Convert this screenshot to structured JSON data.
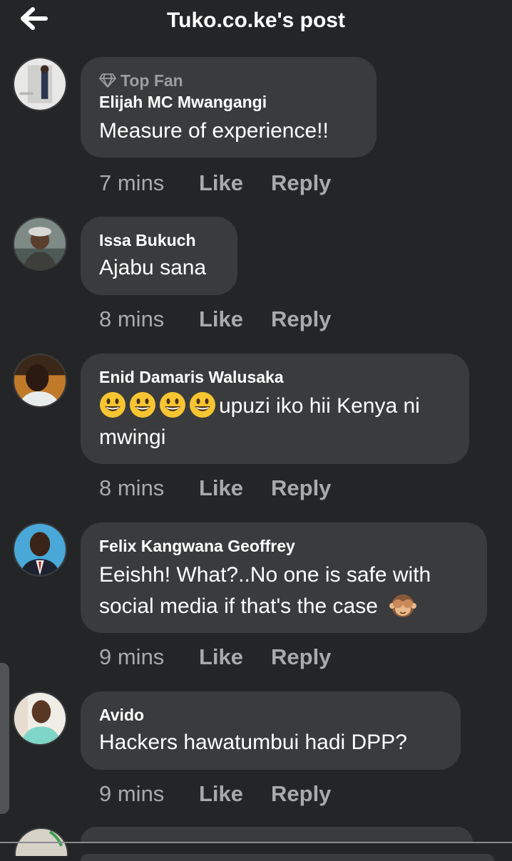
{
  "header": {
    "title": "Tuko.co.ke's post"
  },
  "comments": [
    {
      "badge": "Top Fan",
      "author": "Elijah MC Mwangangi",
      "text": "Measure of experience!!",
      "time": "7 mins",
      "like": "Like",
      "reply": "Reply"
    },
    {
      "author": "Issa Bukuch",
      "text": "Ajabu sana",
      "time": "8 mins",
      "like": "Like",
      "reply": "Reply"
    },
    {
      "author": "Enid Damaris Walusaka",
      "text_line1": "upuzi iko hii Kenya ni",
      "text_line2": "mwingi",
      "emoji_count": 4,
      "time": "8 mins",
      "like": "Like",
      "reply": "Reply"
    },
    {
      "author": "Felix Kangwana Geoffrey",
      "text_line1": "Eeishh! What?..No one is safe with",
      "text_line2": "social media if that's the case",
      "time": "9 mins",
      "like": "Like",
      "reply": "Reply"
    },
    {
      "author": "Avido",
      "text": "Hackers hawatumbui hadi DPP?",
      "time": "9 mins",
      "like": "Like",
      "reply": "Reply"
    }
  ],
  "icons": {
    "back": "back-arrow-icon",
    "badge": "diamond-icon",
    "grin": "grinning-face-emoji",
    "monkey": "see-no-evil-monkey-emoji"
  }
}
